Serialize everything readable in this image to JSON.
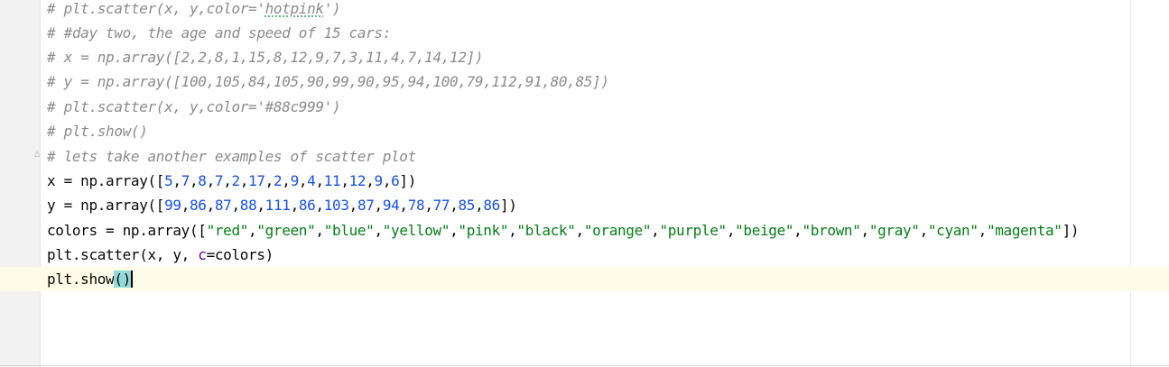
{
  "editor": {
    "lines": [
      "# plt.scatter(x, y,color='hotpink')",
      "# #day two, the age and speed of 15 cars:",
      "# x = np.array([2,2,8,1,15,8,12,9,7,3,11,4,7,14,12])",
      "# y = np.array([100,105,84,105,90,99,90,95,94,100,79,112,91,80,85])",
      "# plt.scatter(x, y,color='#88c999')",
      "# plt.show()",
      "# lets take another examples of scatter plot",
      "x = np.array([5,7,8,7,2,17,2,9,4,11,12,9,6])",
      "y = np.array([99,86,87,88,111,86,103,87,94,78,77,85,86])",
      "colors = np.array([\"red\",\"green\",\"blue\",\"yellow\",\"pink\",\"black\",\"orange\",\"purple\",\"beige\",\"brown\",\"gray\",\"cyan\",\"magenta\"])",
      "plt.scatter(x, y, c=colors)",
      "plt.show()"
    ],
    "x_values": [
      "5",
      "7",
      "8",
      "7",
      "2",
      "17",
      "2",
      "9",
      "4",
      "11",
      "12",
      "9",
      "6"
    ],
    "y_values": [
      "99",
      "86",
      "87",
      "88",
      "111",
      "86",
      "103",
      "87",
      "94",
      "78",
      "77",
      "85",
      "86"
    ],
    "color_values": [
      "red",
      "green",
      "blue",
      "yellow",
      "pink",
      "black",
      "orange",
      "purple",
      "beige",
      "brown",
      "gray",
      "cyan",
      "magenta"
    ],
    "tokens": {
      "x_assign": "x = np.array([",
      "y_assign": "y = np.array([",
      "colors_assign": "colors = np.array([",
      "close": "])",
      "scatter_prefix": "plt.scatter(x, y, ",
      "scatter_param": "c",
      "scatter_suffix": "=colors)",
      "show_prefix": "plt.show",
      "show_parens": "()",
      "comment1_prefix": "# plt.scatter(x, y,color='",
      "comment1_word": "hotpink",
      "comment1_suffix": "')"
    },
    "fold_icon": "fold-marker-icon",
    "colors": {
      "comment": "#8c8c8c",
      "string": "#067d17",
      "number": "#1750eb",
      "keyword_param": "#660099",
      "text": "#080808",
      "current_line": "#fefbe8",
      "brace_highlight": "#93d9d9"
    }
  }
}
